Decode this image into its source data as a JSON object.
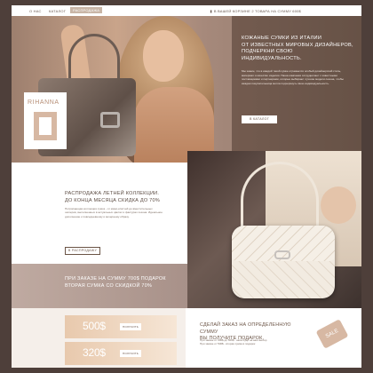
{
  "nav": {
    "items": [
      "О НАС",
      "КАТАЛОГ",
      "РАСПРОДАЖА"
    ],
    "cart_text": "В ВАШЕЙ КОРЗИНЕ 2 ТОВАРА НА СУММУ 600$"
  },
  "hero": {
    "heading_lines": [
      "КОЖАНЫЕ СУМКИ ИЗ ИТАЛИИ",
      "ОТ ИЗВЕСТНЫХ МИРОВЫХ ДИЗАЙНЕРОВ,",
      "ПОДЧЕРКНИ СВОЮ ИНДИВИДУАЛЬНОСТЬ."
    ],
    "body": "Мы знаем, что в каждой такой сумке отражается особый дизайнерский стиль, материал и качество изделия. Наша компания сотрудничает с известными поставщиками и партнерами, которые выбирают лучшие модели сезона, чтобы каждая покупательница могла подчеркнуть свою индивидуальность.",
    "catalog_button": "В КАТАЛОГ",
    "brand_card_title": "RIHANNA"
  },
  "sale": {
    "title_lines": [
      "РАСПРОДАЖА ЛЕТНЕЙ КОЛЛЕКЦИИ.",
      "ДО КОНЦА МЕСЯЦА СКИДКА ДО 70%"
    ],
    "body": "Потрясающая коллекция сумок - от мини-клатчей до вместительных шоперов, выполненных в актуальных цветах и фактурах сезона. Идеальное дополнение к повседневному и вечернему образу.",
    "button": "В РАСПРОДАЖУ"
  },
  "gift": {
    "lines": [
      "ПРИ ЗАКАЗЕ НА СУММУ 700$ ПОДАРОК",
      "ВТОРАЯ СУМКА СО СКИДКОЙ 70%"
    ]
  },
  "prices": [
    {
      "value": "500$",
      "button": "ПОЛУЧИТЬ"
    },
    {
      "value": "320$",
      "button": "ПОЛУЧИТЬ"
    }
  ],
  "order": {
    "title_lines": [
      "СДЕЛАЙ ЗАКАЗ НА ОПРЕДЕЛЕННУЮ СУММУ",
      "ВЫ ПОЛУЧИТЕ ПОДАРОК."
    ],
    "lines": [
      "При заказе от 300$ до 500$ - аксессуар на ваш выбор",
      "При заказе от 500$ - вторая сумка в подарок"
    ],
    "tag": "SALE"
  }
}
